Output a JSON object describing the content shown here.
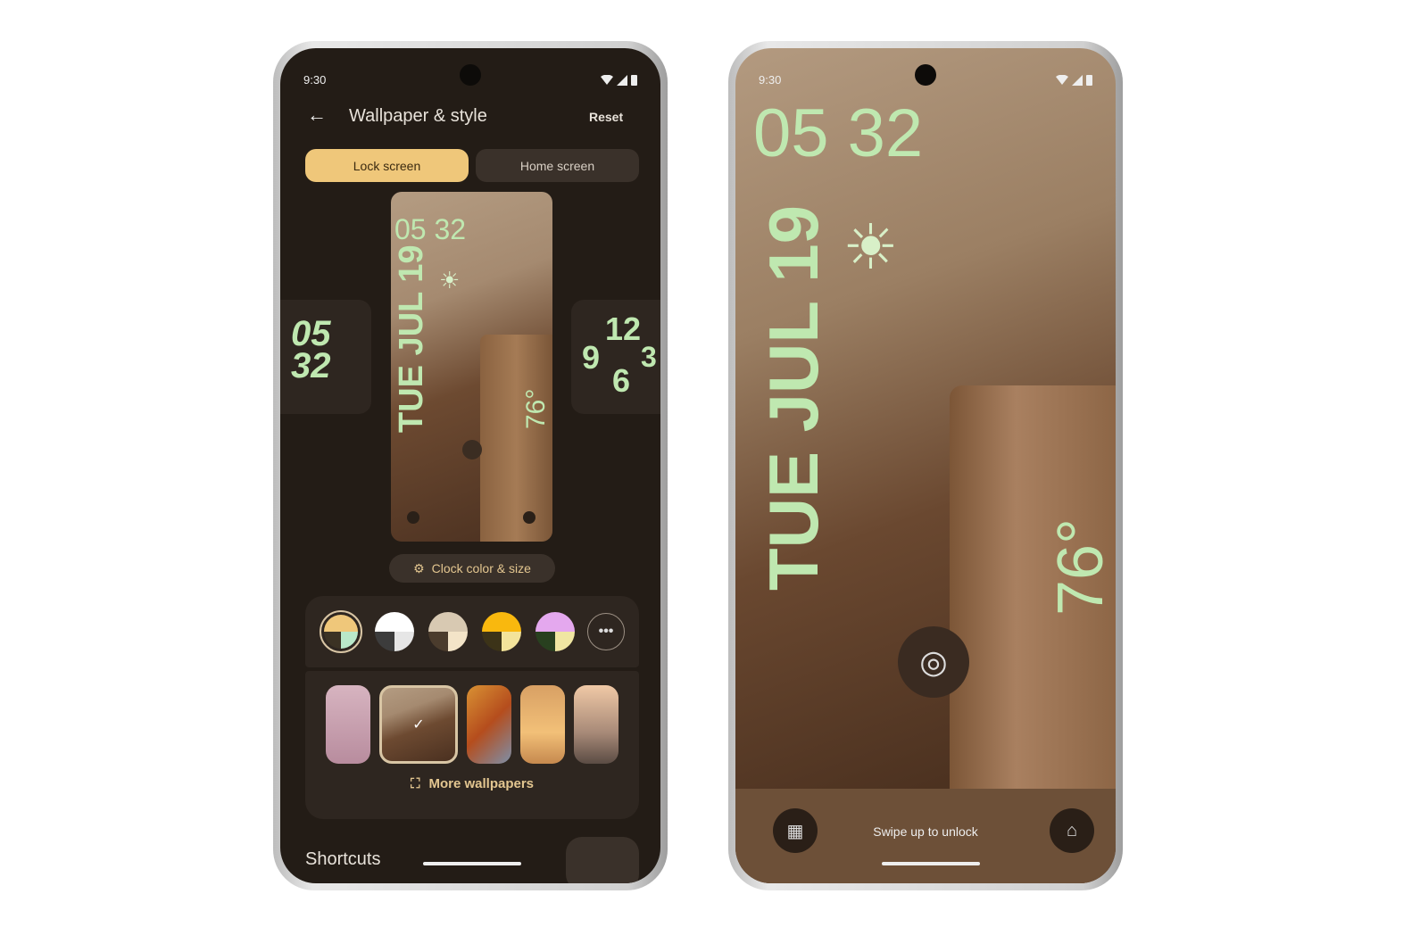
{
  "left_phone": {
    "status_time": "9:30",
    "header": {
      "back_icon": "arrow-left-icon",
      "title": "Wallpaper & style",
      "reset_label": "Reset"
    },
    "tabs": [
      {
        "label": "Lock screen",
        "selected": true
      },
      {
        "label": "Home screen",
        "selected": false
      }
    ],
    "clock_styles": {
      "left": {
        "line1": "05",
        "line2": "32"
      },
      "right": {
        "n12": "12",
        "n9": "9",
        "n3": "3",
        "n6": "6"
      }
    },
    "preview": {
      "time": "05 32",
      "date": "TUE JUL 19",
      "temp": "76°"
    },
    "clock_button": {
      "icon": "gear-icon",
      "label": "Clock color & size"
    },
    "colors": [
      {
        "top": "#efc77a",
        "bl": "#3b3224",
        "br": "#b9e8c9",
        "selected": true
      },
      {
        "top": "#ffffff",
        "bl": "#3c3c3c",
        "br": "#e6e6e6",
        "selected": false
      },
      {
        "top": "#d8c9b2",
        "bl": "#4b3c2d",
        "br": "#f3e4c8",
        "selected": false
      },
      {
        "top": "#f9b80e",
        "bl": "#3c3318",
        "br": "#f3e39a",
        "selected": false
      },
      {
        "top": "#e4a8ee",
        "bl": "#28401f",
        "br": "#f0e6a2",
        "selected": false
      }
    ],
    "more_colors_icon": "more-horizontal-icon",
    "wallpapers": [
      {
        "name": "pink-waves",
        "selected": false
      },
      {
        "name": "rock-vase",
        "selected": true
      },
      {
        "name": "orange-abstract",
        "selected": false
      },
      {
        "name": "dunes",
        "selected": false
      },
      {
        "name": "city",
        "selected": false
      }
    ],
    "more_wallpapers_label": "More wallpapers",
    "shortcuts_label": "Shortcuts"
  },
  "right_phone": {
    "status_time": "9:30",
    "time": "05 32",
    "date": "TUE JUL 19",
    "temp": "76°",
    "weather_icon": "partly-sunny-icon",
    "fingerprint_icon": "fingerprint-icon",
    "qr_icon": "qr-code-icon",
    "home_icon": "home-icon",
    "unlock_hint": "Swipe up to unlock"
  },
  "colors": {
    "accent": "#efc77a",
    "clock_green": "#bfe8b0",
    "background": "#231c16"
  }
}
